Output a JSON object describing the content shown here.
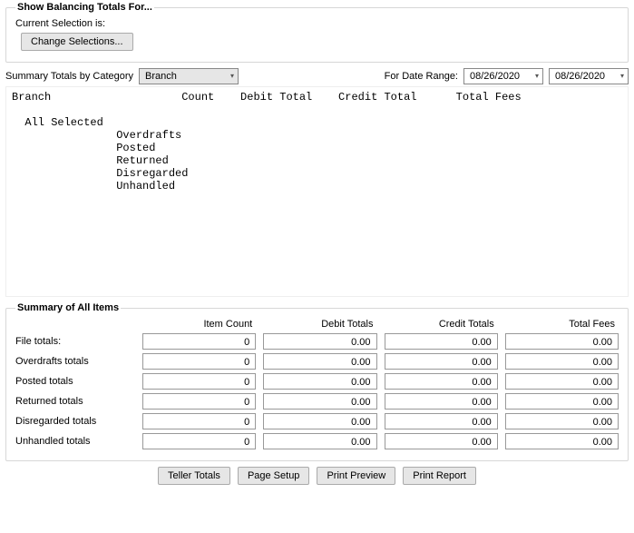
{
  "topBox": {
    "legend": "Show Balancing Totals For...",
    "currentSelectionLabel": "Current Selection is:",
    "changeBtn": "Change Selections..."
  },
  "filters": {
    "categoryLabel": "Summary Totals by Category",
    "categoryValue": "Branch",
    "dateRangeLabel": "For Date Range:",
    "dateFrom": "08/26/2020",
    "dateTo": "08/26/2020"
  },
  "report": {
    "header": "Branch                    Count    Debit Total    Credit Total      Total Fees",
    "blank": "",
    "allSelected": "  All Selected",
    "lines": [
      "                Overdrafts",
      "                Posted",
      "                Returned",
      "                Disregarded",
      "                Unhandled"
    ]
  },
  "summary": {
    "legend": "Summary of All Items",
    "headers": [
      "Item Count",
      "Debit Totals",
      "Credit Totals",
      "Total Fees"
    ],
    "rows": [
      {
        "label": "File totals:",
        "count": "0",
        "debit": "0.00",
        "credit": "0.00",
        "fees": "0.00"
      },
      {
        "label": "Overdrafts totals",
        "count": "0",
        "debit": "0.00",
        "credit": "0.00",
        "fees": "0.00"
      },
      {
        "label": "Posted totals",
        "count": "0",
        "debit": "0.00",
        "credit": "0.00",
        "fees": "0.00"
      },
      {
        "label": "Returned totals",
        "count": "0",
        "debit": "0.00",
        "credit": "0.00",
        "fees": "0.00"
      },
      {
        "label": "Disregarded totals",
        "count": "0",
        "debit": "0.00",
        "credit": "0.00",
        "fees": "0.00"
      },
      {
        "label": "Unhandled totals",
        "count": "0",
        "debit": "0.00",
        "credit": "0.00",
        "fees": "0.00"
      }
    ]
  },
  "buttons": {
    "tellerTotals": "Teller Totals",
    "pageSetup": "Page Setup",
    "printPreview": "Print Preview",
    "printReport": "Print Report"
  }
}
